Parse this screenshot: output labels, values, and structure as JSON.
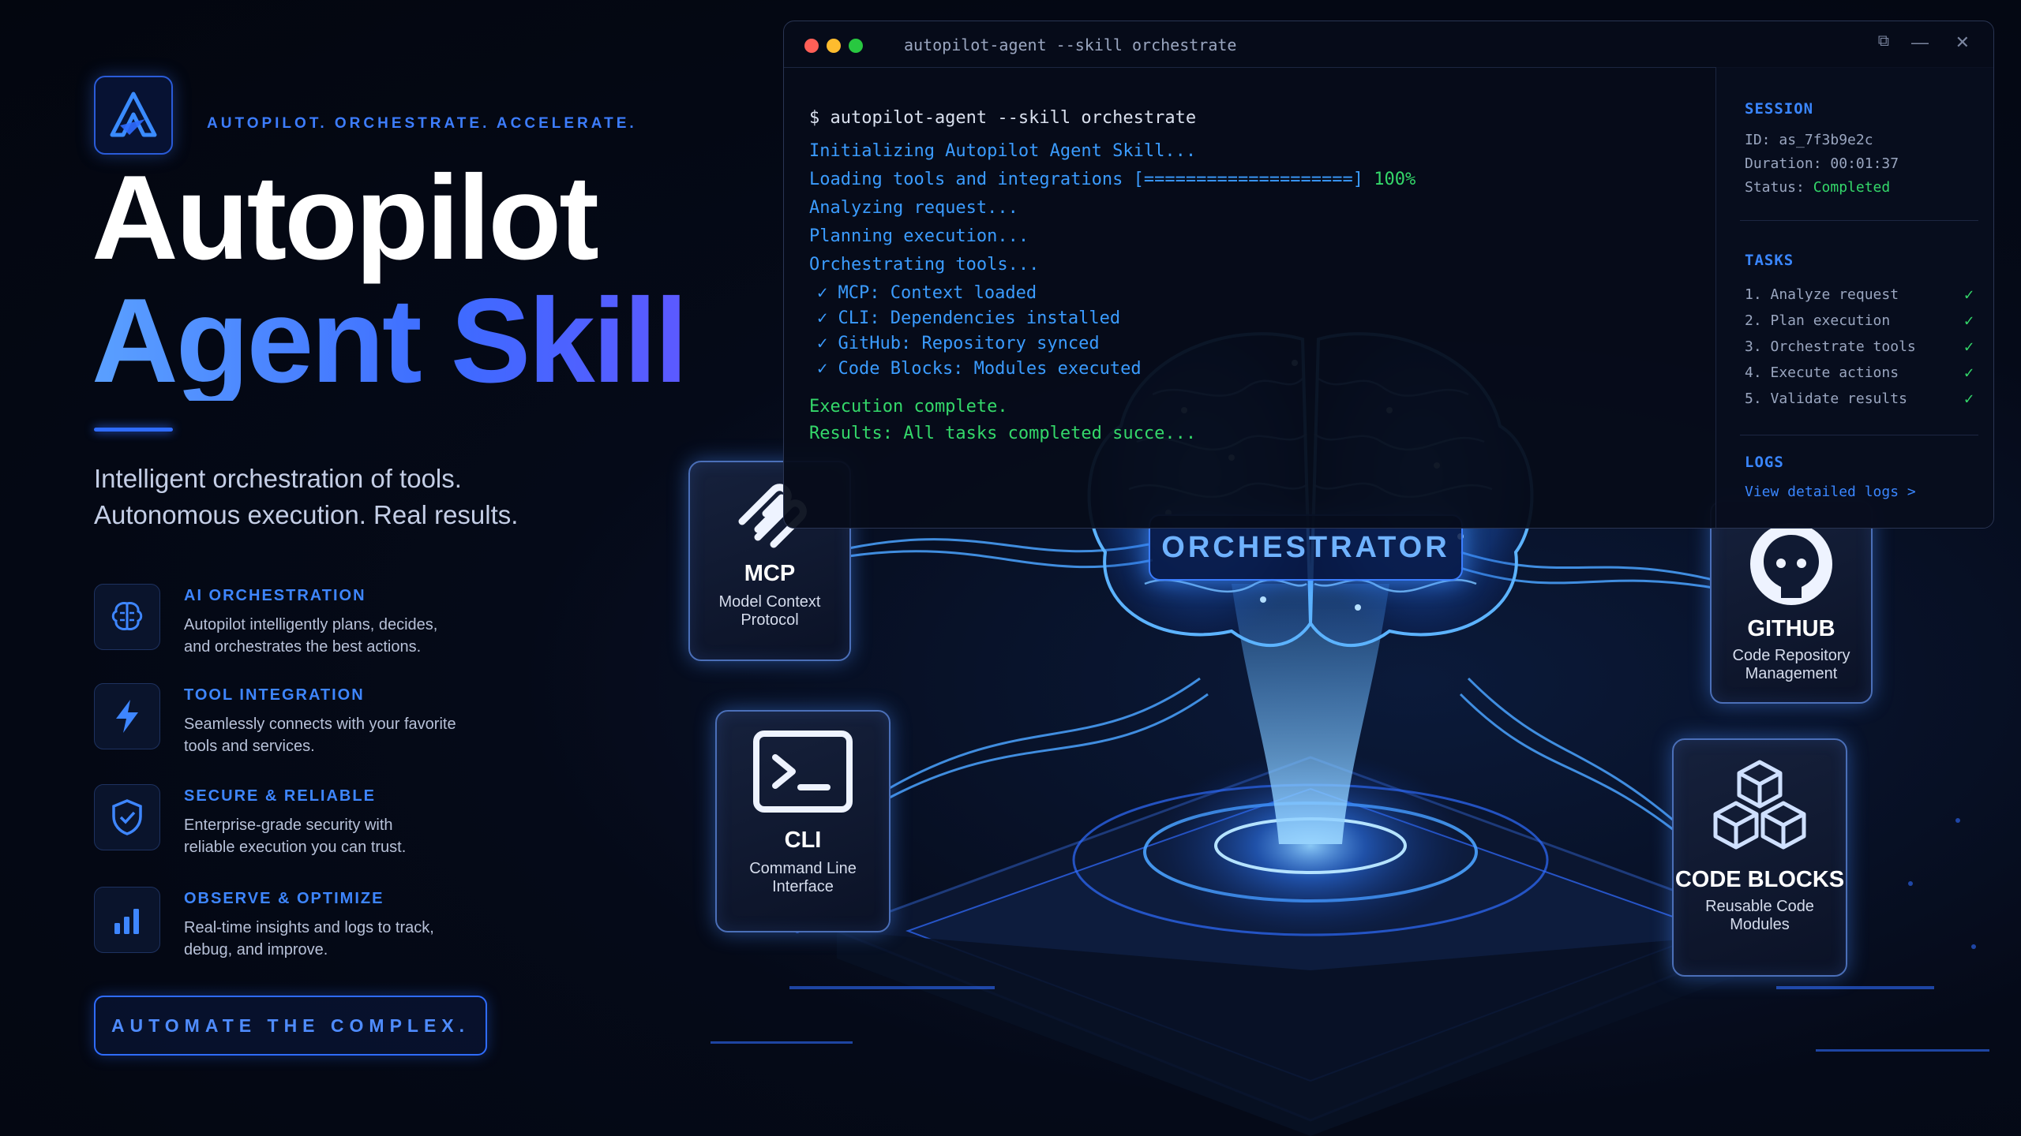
{
  "brand": {
    "tagline": "AUTOPILOT. ORCHESTRATE. ACCELERATE.",
    "title_line1": "Autopilot",
    "title_line2": "Agent Skill",
    "subtitle_line1": "Intelligent orchestration of tools.",
    "subtitle_line2": "Autonomous execution. Real results."
  },
  "features": [
    {
      "icon": "brain-icon",
      "title": "AI ORCHESTRATION",
      "line1": "Autopilot intelligently plans, decides,",
      "line2": "and orchestrates the best actions."
    },
    {
      "icon": "lightning-icon",
      "title": "TOOL INTEGRATION",
      "line1": "Seamlessly connects with your favorite",
      "line2": "tools and services."
    },
    {
      "icon": "shield-check-icon",
      "title": "SECURE & RELIABLE",
      "line1": "Enterprise-grade security with",
      "line2": "reliable execution you can trust."
    },
    {
      "icon": "bar-chart-icon",
      "title": "OBSERVE & OPTIMIZE",
      "line1": "Real-time insights and logs to track,",
      "line2": "debug, and improve."
    }
  ],
  "cta_label": "AUTOMATE THE COMPLEX.",
  "terminal": {
    "window_title": "autopilot-agent --skill orchestrate",
    "lines": [
      "$ autopilot-agent --skill orchestrate",
      "Initializing Autopilot Agent Skill...",
      "Loading tools and integrations [====================]",
      "Analyzing request...",
      "Planning execution...",
      "Orchestrating tools...",
      "✓ MCP: Context loaded",
      "✓ CLI: Dependencies installed",
      "✓ GitHub: Repository synced",
      "✓ Code Blocks: Modules executed",
      "Execution complete.",
      "Results: All tasks completed succe..."
    ],
    "progress_text": "100%",
    "progress": 1.0
  },
  "session": {
    "header": "SESSION",
    "id_label": "ID:",
    "id_value": "as_7f3b9e2c",
    "duration_label": "Duration:",
    "duration_value": "00:01:37",
    "status_label": "Status:",
    "status_value": "Completed",
    "tasks_header": "TASKS",
    "tasks": [
      "1. Analyze request",
      "2. Plan execution",
      "3. Orchestrate tools",
      "4. Execute actions",
      "5. Validate results"
    ],
    "logs_header": "LOGS",
    "logs_link": "View detailed logs >"
  },
  "modules": {
    "mcp": {
      "name": "MCP",
      "line1": "Model Context",
      "line2": "Protocol"
    },
    "cli": {
      "name": "CLI",
      "line1": "Command Line",
      "line2": "Interface"
    },
    "github": {
      "name": "GITHUB",
      "line1": "Code Repository",
      "line2": "Management"
    },
    "code_blocks": {
      "name": "CODE BLOCKS",
      "line1": "Reusable Code",
      "line2": "Modules"
    }
  },
  "orchestrator_label": "ORCHESTRATOR",
  "colors": {
    "accent": "#2f6cff",
    "terminal_text": "#3b9cff",
    "success": "#34d86a",
    "background": "#050a18"
  }
}
